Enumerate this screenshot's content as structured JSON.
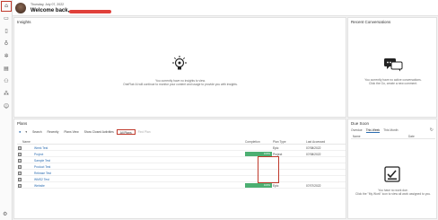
{
  "header": {
    "date": "Thursday, July 07, 2022",
    "welcome": "Welcome back,"
  },
  "insights": {
    "title": "Insights",
    "empty_line1": "You currently have no insights to view.",
    "empty_line2": "OneFlair AI will continue to monitor your content and usage to provide you with insights."
  },
  "recent_conversations": {
    "title": "Recent Conversations",
    "empty_line1": "You currently have no active conversations.",
    "empty_line2": "Click the Go, create a new comment."
  },
  "plans": {
    "title": "Plans",
    "toolbar": [
      "Search",
      "Recently",
      "Plans View",
      "Show Closed Activities",
      "All Plans",
      "Find Plan"
    ],
    "columns": {
      "name": "Name",
      "completion": "Completion",
      "type": "Plan Type",
      "last_accessed": "Last Accessed"
    },
    "rows": [
      {
        "name": "Week Test",
        "completion": "",
        "type": "Epic",
        "last_accessed": "07/08/2022"
      },
      {
        "name": "Project",
        "completion": "100%",
        "type": "Project",
        "last_accessed": "07/08/2022"
      },
      {
        "name": "Sample Test",
        "completion": "",
        "type": "",
        "last_accessed": ""
      },
      {
        "name": "Product Test",
        "completion": "",
        "type": "",
        "last_accessed": ""
      },
      {
        "name": "Release Test",
        "completion": "",
        "type": "",
        "last_accessed": ""
      },
      {
        "name": "WMS2 Test",
        "completion": "",
        "type": "",
        "last_accessed": ""
      },
      {
        "name": "Website",
        "completion": "100%",
        "type": "Epic",
        "last_accessed": "07/07/2022"
      }
    ]
  },
  "due_soon": {
    "title": "Due Soon",
    "tabs": [
      "Overdue",
      "This Week",
      "This Month"
    ],
    "columns": {
      "name": "Name",
      "date": "Date"
    },
    "empty_line1": "You have no work due.",
    "empty_line2": "Click the \"My Work\" icon to view all work assigned to you."
  },
  "icons": {
    "home": "home-icon",
    "settings": "gear-icon",
    "accent": "#c0392b",
    "progress": "#4caf72"
  }
}
